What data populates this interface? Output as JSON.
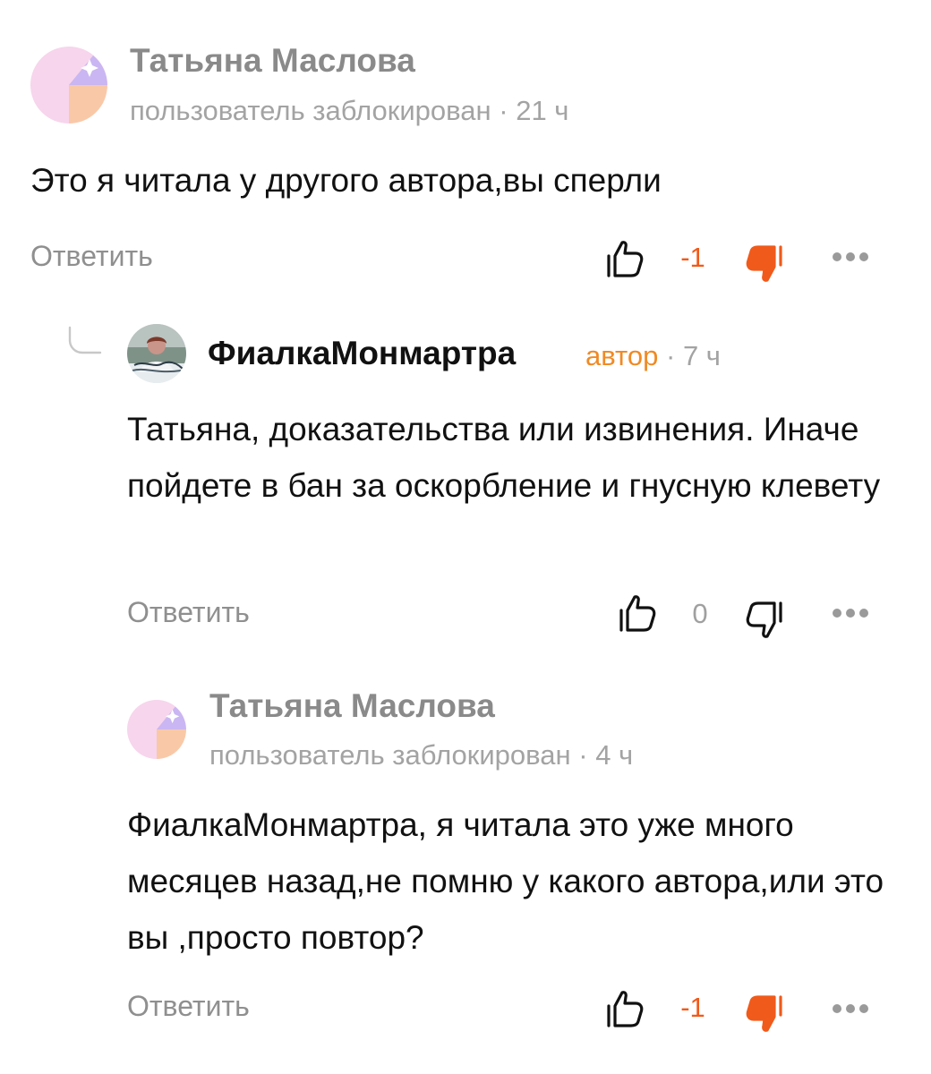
{
  "comments": [
    {
      "author": "Татьяна Маслова",
      "status": "пользователь заблокирован",
      "badge": "",
      "separator": "·",
      "time": "21 ч",
      "text": "Это я читала у другого автора,вы сперли",
      "reply_label": "Ответить",
      "score": "-1",
      "vote": "dislike"
    },
    {
      "author": "ФиалкаМонмартра",
      "status": "",
      "badge": "автор",
      "separator": "·",
      "time": "7 ч",
      "text": "Татьяна, доказательства или извинения. Иначе пойдете в бан за оскорбление и гнусную клевету",
      "reply_label": "Ответить",
      "score": "0",
      "vote": "none"
    },
    {
      "author": "Татьяна Маслова",
      "status": "пользователь заблокирован",
      "badge": "",
      "separator": "·",
      "time": "4 ч",
      "text": "ФиалкаМонмартра, я читала это уже много месяцев назад,не помню у какого автора,или это вы ,просто повтор?",
      "reply_label": "Ответить",
      "score": "-1",
      "vote": "dislike"
    }
  ],
  "colors": {
    "negative": "#f05a1a",
    "badge": "#f08a24",
    "muted": "#8f8f8f"
  },
  "icons": [
    "like-icon",
    "dislike-icon",
    "more-icon",
    "reply-thread-icon"
  ]
}
